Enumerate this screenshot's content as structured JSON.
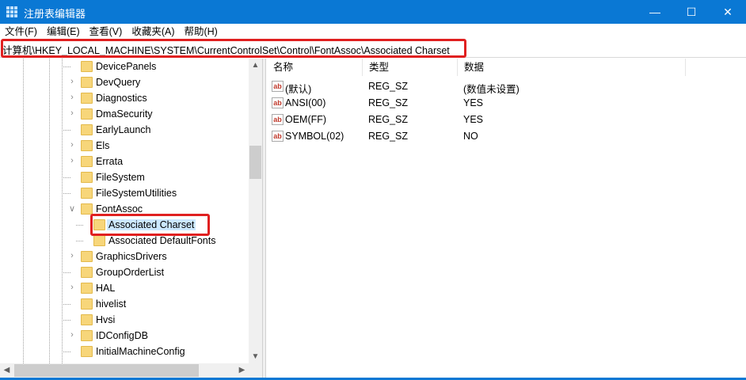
{
  "window": {
    "title": "注册表编辑器",
    "minimize": "—",
    "maximize": "☐",
    "close": "✕",
    "accent": "#0a78d4"
  },
  "menu": [
    "文件(F)",
    "编辑(E)",
    "查看(V)",
    "收藏夹(A)",
    "帮助(H)"
  ],
  "address": "计算机\\HKEY_LOCAL_MACHINE\\SYSTEM\\CurrentControlSet\\Control\\FontAssoc\\Associated Charset",
  "tree": [
    {
      "label": "DevicePanels",
      "level": 0,
      "expander": "none"
    },
    {
      "label": "DevQuery",
      "level": 0,
      "expander": "collapsed"
    },
    {
      "label": "Diagnostics",
      "level": 0,
      "expander": "collapsed"
    },
    {
      "label": "DmaSecurity",
      "level": 0,
      "expander": "collapsed"
    },
    {
      "label": "EarlyLaunch",
      "level": 0,
      "expander": "none"
    },
    {
      "label": "Els",
      "level": 0,
      "expander": "collapsed"
    },
    {
      "label": "Errata",
      "level": 0,
      "expander": "collapsed"
    },
    {
      "label": "FileSystem",
      "level": 0,
      "expander": "none"
    },
    {
      "label": "FileSystemUtilities",
      "level": 0,
      "expander": "none"
    },
    {
      "label": "FontAssoc",
      "level": 0,
      "expander": "expanded"
    },
    {
      "label": "Associated Charset",
      "level": 1,
      "expander": "none",
      "selected": true
    },
    {
      "label": "Associated DefaultFonts",
      "level": 1,
      "expander": "none"
    },
    {
      "label": "GraphicsDrivers",
      "level": 0,
      "expander": "collapsed"
    },
    {
      "label": "GroupOrderList",
      "level": 0,
      "expander": "none"
    },
    {
      "label": "HAL",
      "level": 0,
      "expander": "collapsed"
    },
    {
      "label": "hivelist",
      "level": 0,
      "expander": "none"
    },
    {
      "label": "Hvsi",
      "level": 0,
      "expander": "none"
    },
    {
      "label": "IDConfigDB",
      "level": 0,
      "expander": "collapsed"
    },
    {
      "label": "InitialMachineConfig",
      "level": 0,
      "expander": "none"
    }
  ],
  "columns": [
    "名称",
    "类型",
    "数据"
  ],
  "values": [
    {
      "name": "(默认)",
      "type": "REG_SZ",
      "data": "(数值未设置)",
      "icon": "ab"
    },
    {
      "name": "ANSI(00)",
      "type": "REG_SZ",
      "data": "YES",
      "icon": "ab"
    },
    {
      "name": "OEM(FF)",
      "type": "REG_SZ",
      "data": "YES",
      "icon": "ab"
    },
    {
      "name": "SYMBOL(02)",
      "type": "REG_SZ",
      "data": "NO",
      "icon": "ab"
    }
  ]
}
